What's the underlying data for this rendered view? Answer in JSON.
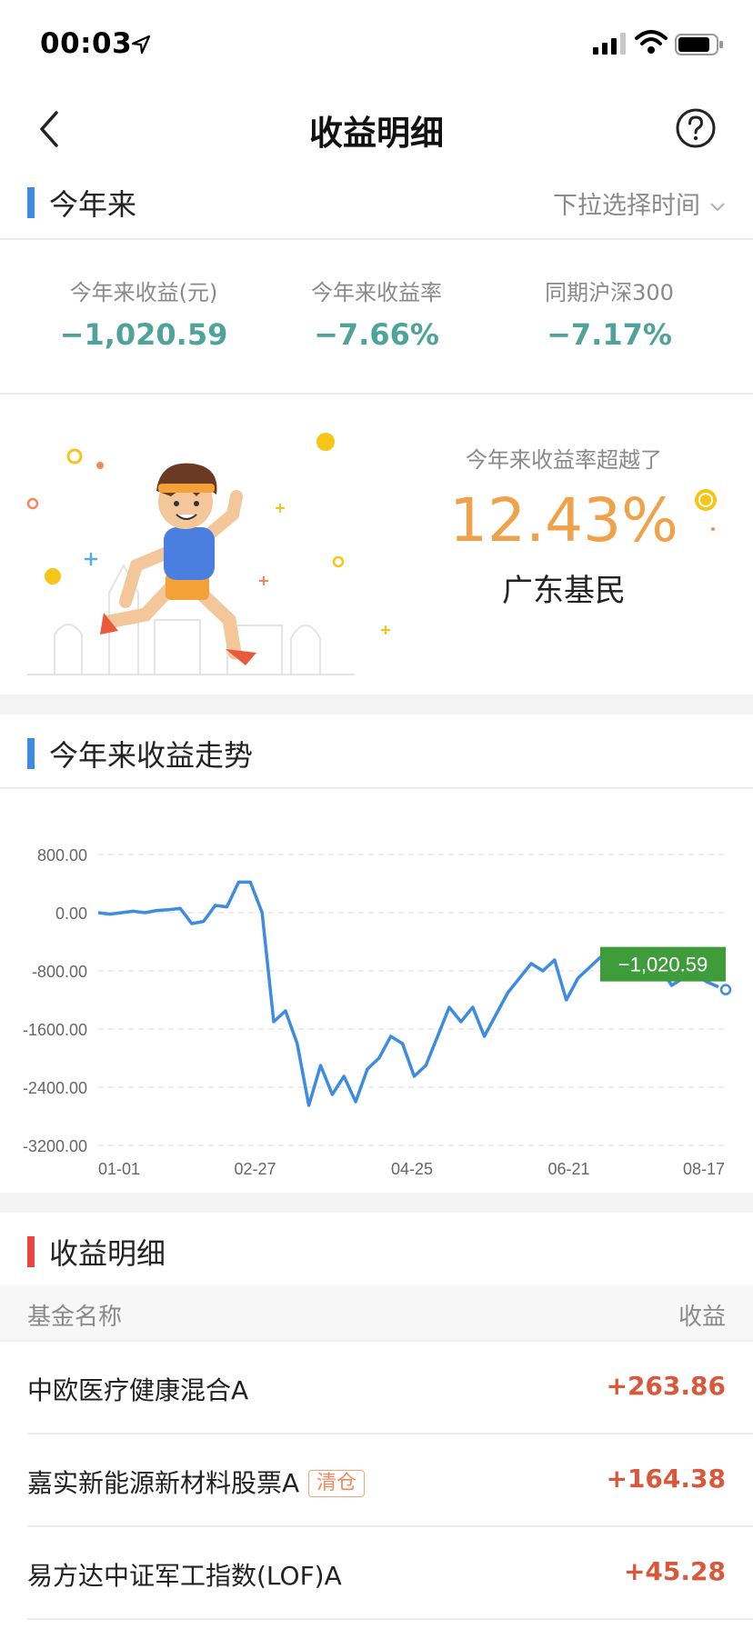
{
  "status_bar": {
    "time": "00:03"
  },
  "nav": {
    "title": "收益明细"
  },
  "ytd_section": {
    "title": "今年来",
    "time_select": "下拉选择时间"
  },
  "summary": [
    {
      "label": "今年来收益(元)",
      "value": "−1,020.59"
    },
    {
      "label": "今年来收益率",
      "value": "−7.66%"
    },
    {
      "label": "同期沪深300",
      "value": "−7.17%"
    }
  ],
  "banner": {
    "label": "今年来收益率超越了",
    "percent": "12.43%",
    "region": "广东基民"
  },
  "trend_section": {
    "title": "今年来收益走势"
  },
  "chart_data": {
    "type": "line",
    "y_ticks": [
      "800.00",
      "0.00",
      "-800.00",
      "-1600.00",
      "-2400.00",
      "-3200.00"
    ],
    "ylim": [
      -3200,
      800
    ],
    "x_ticks": [
      "01-01",
      "02-27",
      "04-25",
      "06-21",
      "08-17"
    ],
    "tooltip": "−1,020.59",
    "line_color": "#3d8ce0",
    "tooltip_color": "#3f9c3a",
    "series": [
      {
        "values": [
          0,
          -20,
          0,
          20,
          0,
          30,
          40,
          60,
          -150,
          -120,
          100,
          80,
          420,
          420,
          0,
          -1500,
          -1350,
          -1800,
          -2650,
          -2100,
          -2500,
          -2250,
          -2600,
          -2150,
          -2000,
          -1700,
          -1800,
          -2250,
          -2100,
          -1700,
          -1300,
          -1500,
          -1300,
          -1700,
          -1400,
          -1100,
          -900,
          -700,
          -800,
          -650,
          -1200,
          -900,
          -750,
          -600,
          -550,
          -600,
          -500,
          -650,
          -750,
          -1000,
          -900,
          -850,
          -950,
          -1020.59
        ]
      }
    ]
  },
  "detail_section": {
    "title": "收益明细",
    "col_name": "基金名称",
    "col_value": "收益"
  },
  "funds": [
    {
      "name": "中欧医疗健康混合A",
      "tag": "",
      "value": "+263.86"
    },
    {
      "name": "嘉实新能源新材料股票A",
      "tag": "清仓",
      "value": "+164.38"
    },
    {
      "name": "易方达中证军工指数(LOF)A",
      "tag": "",
      "value": "+45.28"
    }
  ]
}
